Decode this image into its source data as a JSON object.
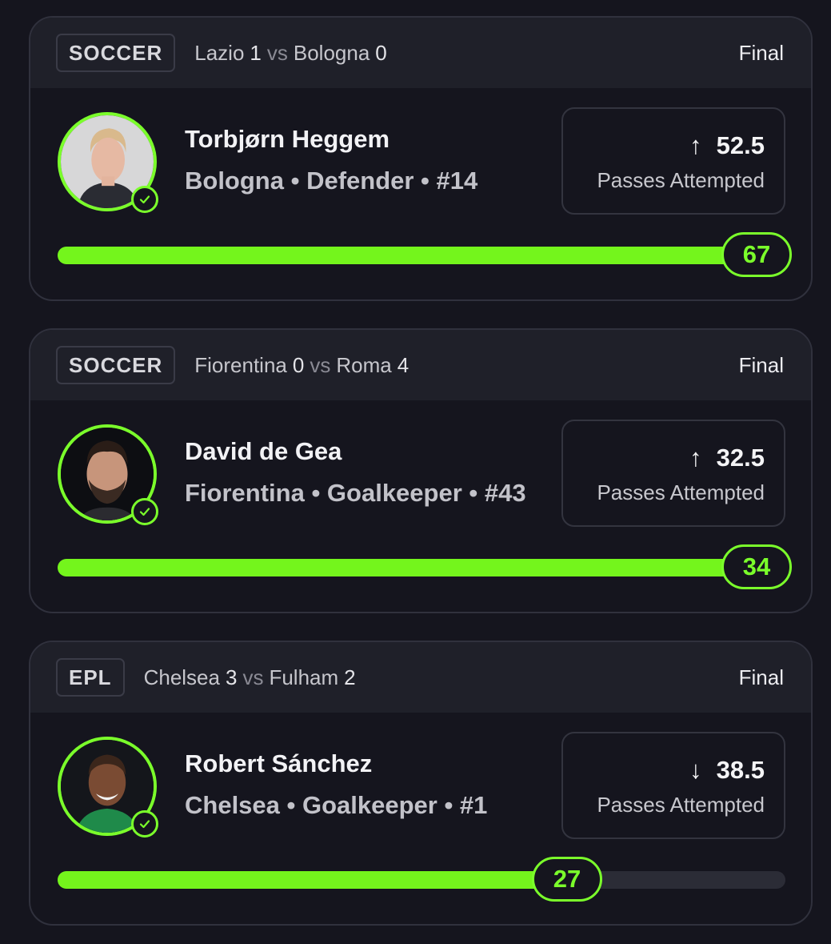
{
  "colors": {
    "accent": "#7bff2b",
    "background": "#15151e",
    "card_header": "#1f2029"
  },
  "cards": [
    {
      "league": "SOCCER",
      "team1": "Lazio",
      "score1": "1",
      "vs": "vs",
      "team2": "Bologna",
      "score2": "0",
      "status": "Final",
      "player": {
        "name": "Torbjørn Heggem",
        "meta": "Bologna • Defender • #14",
        "avatar_icon": "player-photo-icon"
      },
      "line": {
        "direction": "up",
        "arrow": "↑",
        "value": "52.5",
        "stat": "Passes Attempted"
      },
      "actual": {
        "value": "67",
        "progress": 1.0
      }
    },
    {
      "league": "SOCCER",
      "team1": "Fiorentina",
      "score1": "0",
      "vs": "vs",
      "team2": "Roma",
      "score2": "4",
      "status": "Final",
      "player": {
        "name": "David de Gea",
        "meta": "Fiorentina • Goalkeeper • #43",
        "avatar_icon": "player-photo-icon"
      },
      "line": {
        "direction": "up",
        "arrow": "↑",
        "value": "32.5",
        "stat": "Passes Attempted"
      },
      "actual": {
        "value": "34",
        "progress": 1.0
      }
    },
    {
      "league": "EPL",
      "team1": "Chelsea",
      "score1": "3",
      "vs": "vs",
      "team2": "Fulham",
      "score2": "2",
      "status": "Final",
      "player": {
        "name": "Robert Sánchez",
        "meta": "Chelsea • Goalkeeper • #1",
        "avatar_icon": "player-photo-icon"
      },
      "line": {
        "direction": "down",
        "arrow": "↓",
        "value": "38.5",
        "stat": "Passes Attempted"
      },
      "actual": {
        "value": "27",
        "progress": 0.7
      }
    }
  ]
}
